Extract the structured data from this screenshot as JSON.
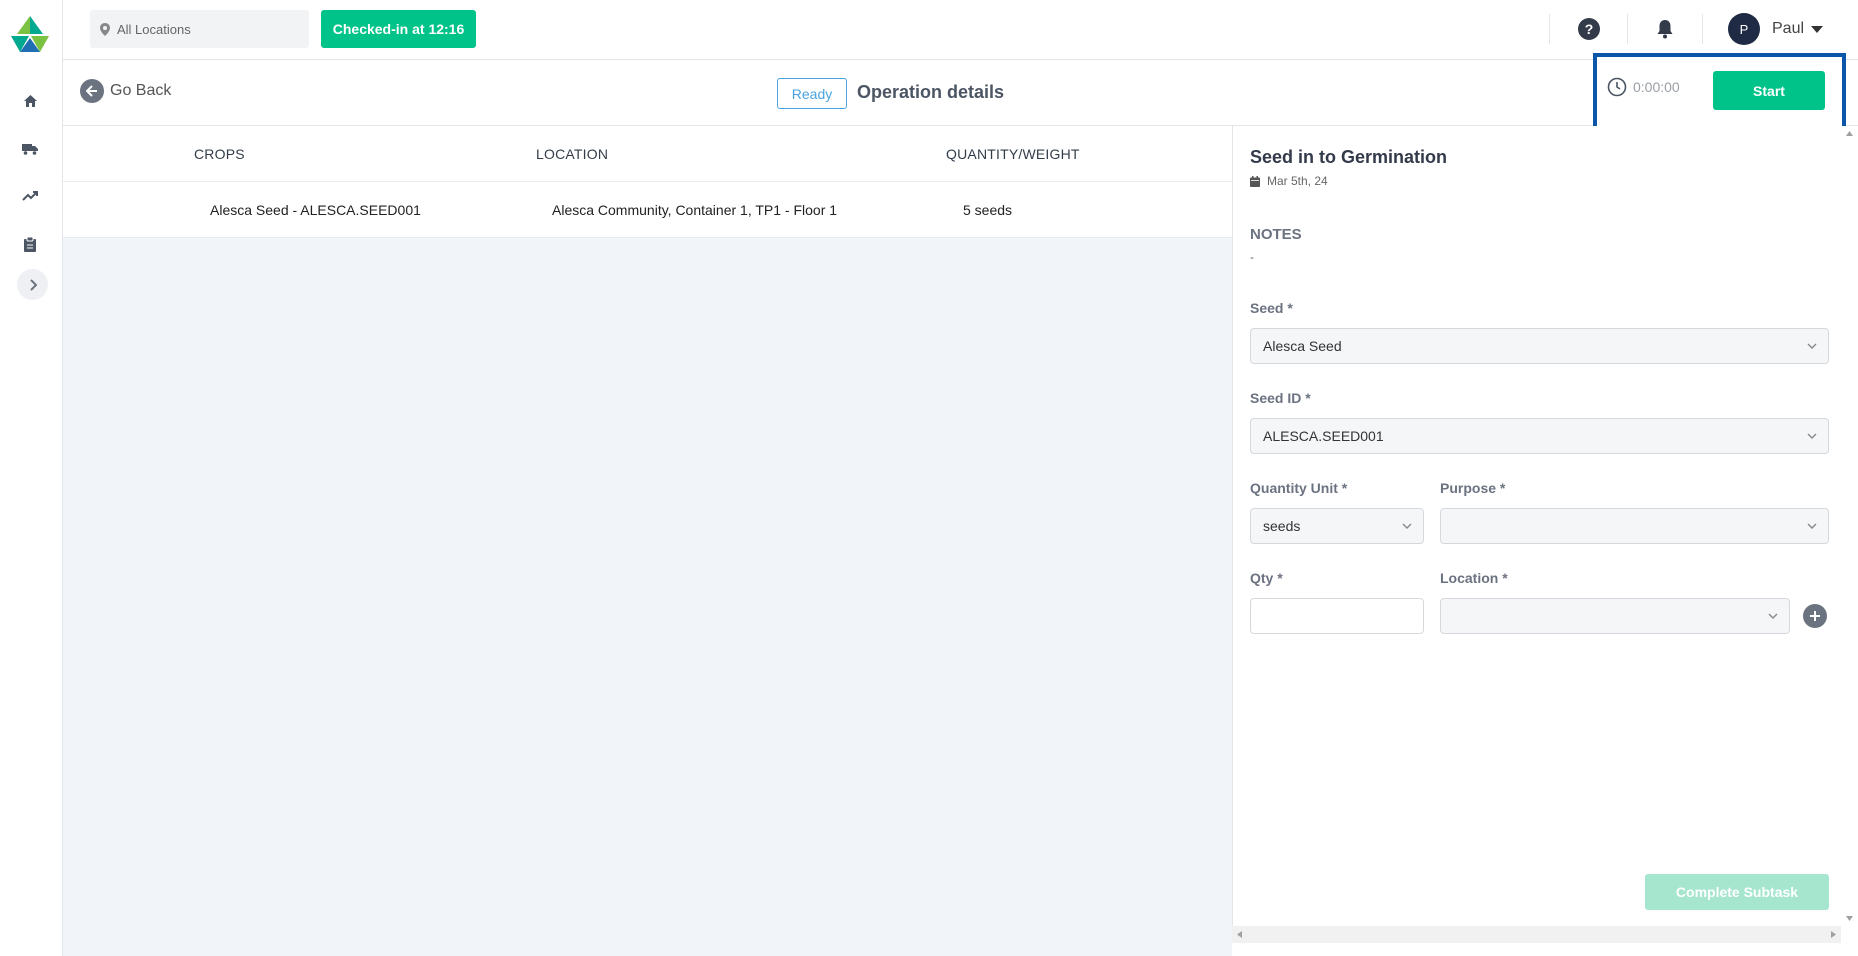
{
  "topbar": {
    "location_filter": "All Locations",
    "checkin_label": "Checked-in at 12:16",
    "user": {
      "initial": "P",
      "name": "Paul"
    }
  },
  "sidebar": {
    "items": [
      {
        "name": "home-icon"
      },
      {
        "name": "truck-icon"
      },
      {
        "name": "trending-up-icon"
      },
      {
        "name": "clipboard-icon"
      }
    ]
  },
  "subheader": {
    "back_label": "Go Back",
    "status": "Ready",
    "title": "Operation details",
    "timer": "0:00:00",
    "start_label": "Start"
  },
  "table": {
    "headers": [
      "CROPS",
      "LOCATION",
      "QUANTITY/WEIGHT"
    ],
    "rows": [
      [
        "Alesca Seed - ALESCA.SEED001",
        "Alesca Community, Container 1, TP1 - Floor 1",
        "5 seeds"
      ]
    ]
  },
  "panel": {
    "title": "Seed in to Germination",
    "date": "Mar 5th, 24",
    "notes_label": "NOTES",
    "notes_value": "-",
    "fields": {
      "seed": {
        "label": "Seed *",
        "value": "Alesca Seed"
      },
      "seed_id": {
        "label": "Seed ID *",
        "value": "ALESCA.SEED001"
      },
      "quantity_unit": {
        "label": "Quantity Unit *",
        "value": "seeds"
      },
      "purpose": {
        "label": "Purpose *",
        "value": ""
      },
      "qty": {
        "label": "Qty *",
        "value": ""
      },
      "location": {
        "label": "Location *",
        "value": ""
      }
    },
    "complete_label": "Complete Subtask"
  },
  "colors": {
    "accent_green": "#00c389",
    "highlight_blue": "#0b56a8",
    "badge_blue": "#4aa3df"
  }
}
